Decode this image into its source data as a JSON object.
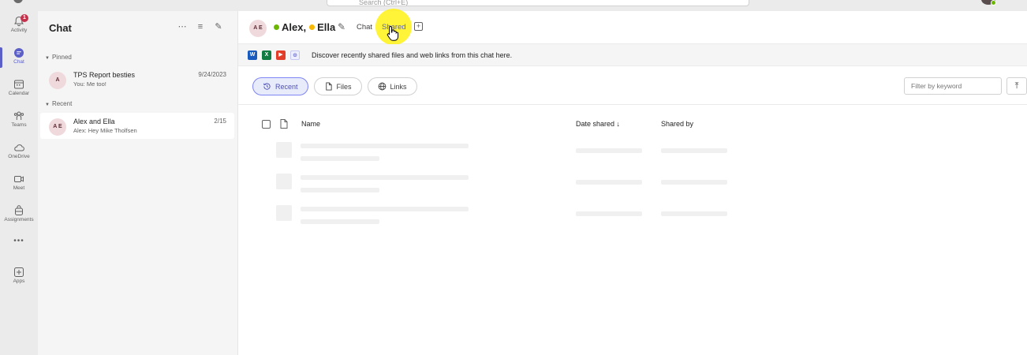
{
  "topbar": {
    "search_placeholder": "Search (Ctrl+E)"
  },
  "rail": {
    "items": [
      {
        "label": "Activity",
        "icon": "bell-icon",
        "badge": "1"
      },
      {
        "label": "Chat",
        "icon": "chat-icon"
      },
      {
        "label": "Calendar",
        "icon": "calendar-icon"
      },
      {
        "label": "Teams",
        "icon": "teams-icon"
      },
      {
        "label": "OneDrive",
        "icon": "cloud-icon"
      },
      {
        "label": "Meet",
        "icon": "video-icon"
      },
      {
        "label": "Assignments",
        "icon": "backpack-icon"
      },
      {
        "label": "Apps",
        "icon": "add-apps-icon"
      }
    ],
    "more": "•••"
  },
  "chatlist": {
    "title": "Chat",
    "sections": {
      "pinned": "Pinned",
      "recent": "Recent"
    },
    "pinned": [
      {
        "name": "TPS Report besties",
        "preview": "You: Me too!",
        "date": "9/24/2023",
        "initials": "A"
      }
    ],
    "recent": [
      {
        "name": "Alex and Ella",
        "preview": "Alex: Hey Mike Tholfsen",
        "date": "2/15",
        "initials": "A E"
      }
    ]
  },
  "header": {
    "initials": "A E",
    "name1": "Alex,",
    "name2": "Ella",
    "tab_chat": "Chat",
    "tab_shared": "Shared",
    "add": "+"
  },
  "banner": {
    "text": "Discover recently shared files and web links from this chat here."
  },
  "filters": {
    "recent": "Recent",
    "files": "Files",
    "links": "Links",
    "search_placeholder": "Filter by keyword"
  },
  "table": {
    "col_name": "Name",
    "col_date": "Date shared",
    "col_date_sort": "↓",
    "col_by": "Shared by"
  },
  "colors": {
    "accent": "#5b5fc7",
    "presence_available": "#6bb700",
    "presence_away": "#f8b700",
    "highlight": "#fff100"
  }
}
